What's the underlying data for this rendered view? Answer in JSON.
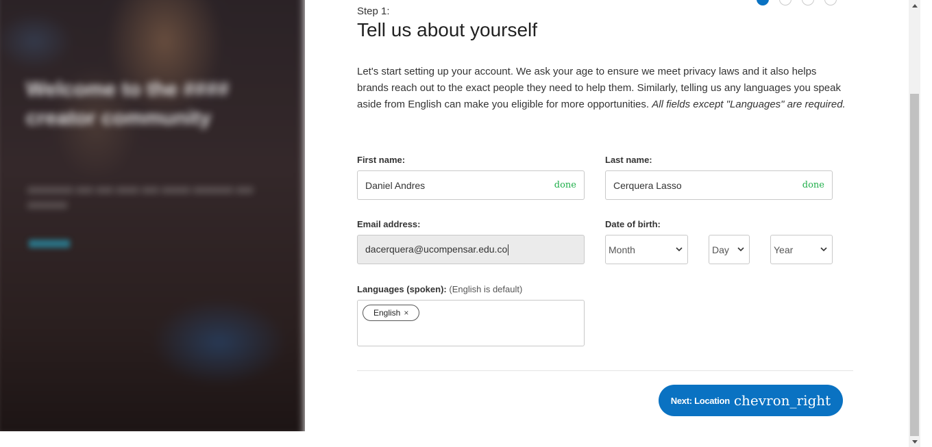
{
  "hero": {
    "headline": "Welcome to the #### creator community",
    "body": "######## ### ### #### ### ##### ####### ### #######",
    "link": "#####"
  },
  "stepper": {
    "total": 4,
    "current": 1
  },
  "step": {
    "label": "Step 1:",
    "title": "Tell us about yourself",
    "intro": "Let's start setting up your account. We ask your age to ensure we meet privacy laws and it also helps brands reach out to the exact people they need to help them. Similarly, telling us any languages you speak aside from English can make you eligible for more opportunities.",
    "intro_emphasis": "All fields except \"Languages\" are required."
  },
  "form": {
    "first_name": {
      "label": "First name:",
      "value": "Daniel Andres",
      "status_icon": "done"
    },
    "last_name": {
      "label": "Last name:",
      "value": "Cerquera Lasso",
      "status_icon": "done"
    },
    "email": {
      "label": "Email address:",
      "value": "dacerquera@ucompensar.edu.co"
    },
    "dob": {
      "label": "Date of birth:",
      "month": "Month",
      "day": "Day",
      "year": "Year"
    },
    "languages": {
      "label": "Languages (spoken):",
      "hint": "(English is default)",
      "tags": [
        "English"
      ],
      "remove_glyph": "×"
    }
  },
  "footer": {
    "next_label": "Next: Location",
    "next_icon": "chevron_right"
  },
  "colors": {
    "primary": "#0a72c2",
    "success": "#1fae4a",
    "border": "#c8c8c8"
  }
}
